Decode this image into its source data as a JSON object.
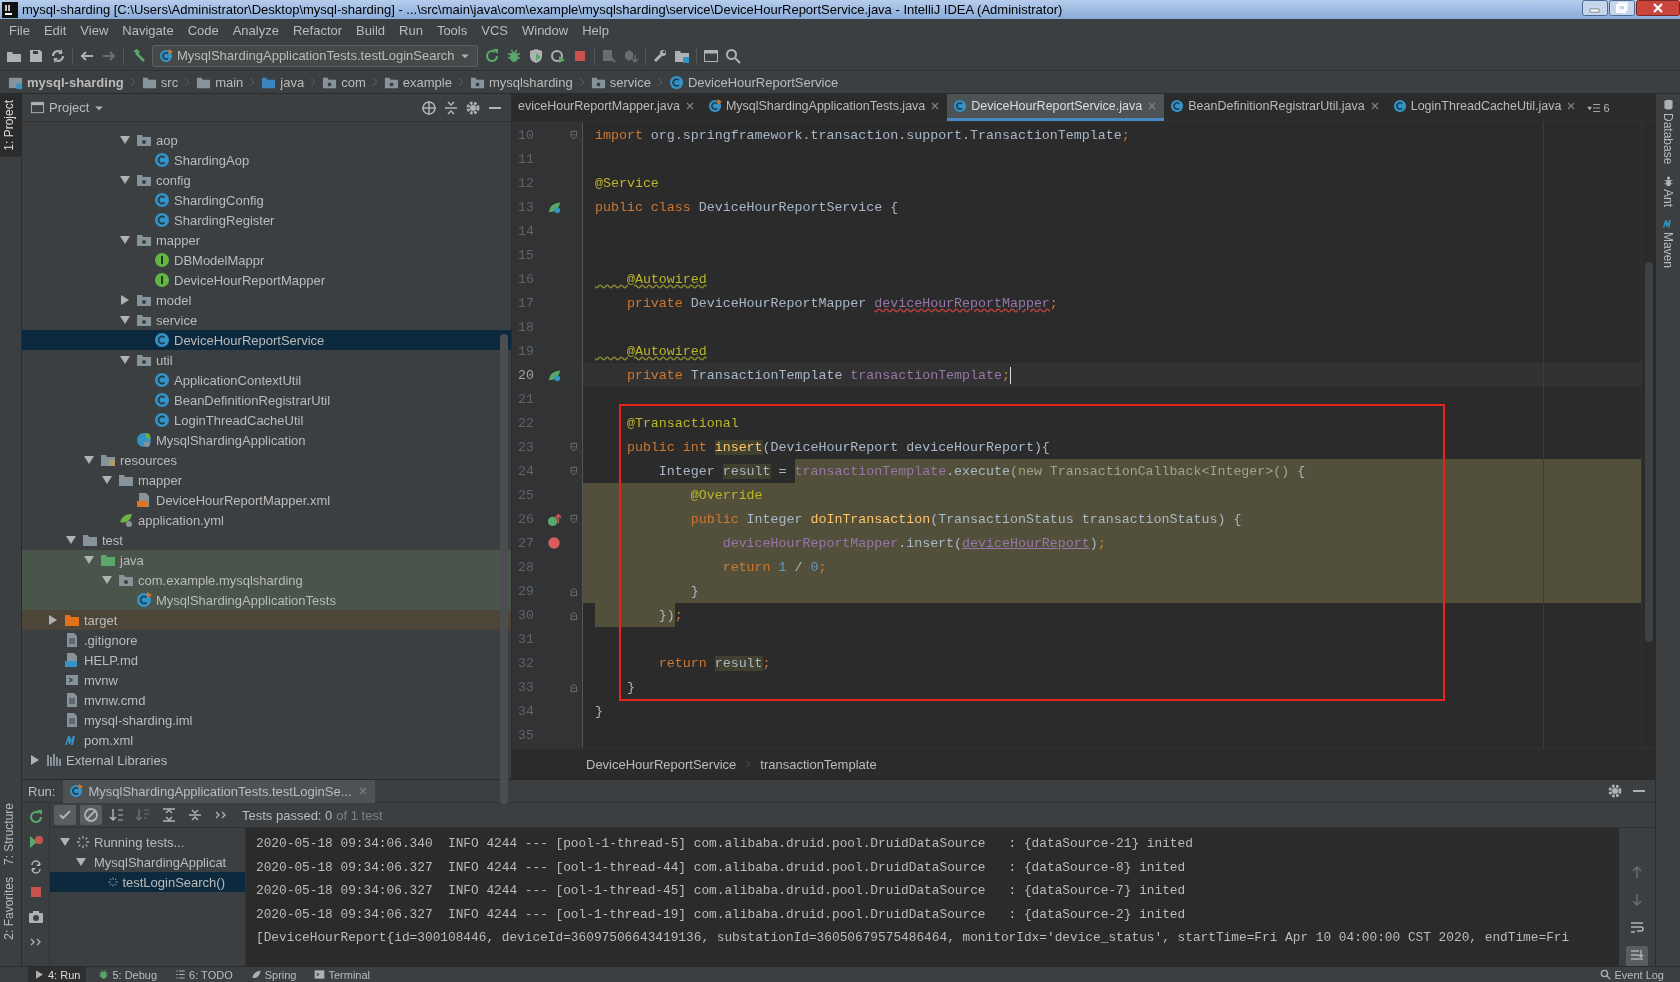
{
  "window": {
    "title": "mysql-sharding [C:\\Users\\Administrator\\Desktop\\mysql-sharding] - ...\\src\\main\\java\\com\\example\\mysqlsharding\\service\\DeviceHourReportService.java - IntelliJ IDEA (Administrator)"
  },
  "menu": [
    "File",
    "Edit",
    "View",
    "Navigate",
    "Code",
    "Analyze",
    "Refactor",
    "Build",
    "Run",
    "Tools",
    "VCS",
    "Window",
    "Help"
  ],
  "toolbar": [
    {
      "kind": "open",
      "disabled": false
    },
    {
      "kind": "save",
      "disabled": false
    },
    {
      "kind": "sync",
      "disabled": false
    },
    {
      "kind": "separator"
    },
    {
      "kind": "back",
      "disabled": false
    },
    {
      "kind": "forward",
      "disabled": true
    },
    {
      "kind": "separator"
    },
    {
      "kind": "hammer",
      "disabled": false
    },
    {
      "kind": "combo",
      "label": "MysqlShardingApplicationTests.testLoginSearch"
    },
    {
      "kind": "rerun",
      "disabled": false
    },
    {
      "kind": "bug",
      "disabled": false
    },
    {
      "kind": "coverage",
      "disabled": false
    },
    {
      "kind": "profile",
      "disabled": false
    },
    {
      "kind": "stop",
      "disabled": false
    },
    {
      "kind": "separator"
    },
    {
      "kind": "attach",
      "disabled": true
    },
    {
      "kind": "update",
      "disabled": true
    },
    {
      "kind": "separator"
    },
    {
      "kind": "wrench",
      "disabled": false
    },
    {
      "kind": "structure",
      "disabled": false
    },
    {
      "kind": "separator"
    },
    {
      "kind": "window",
      "disabled": false
    },
    {
      "kind": "search",
      "disabled": false
    }
  ],
  "nav_path": [
    {
      "label": "mysql-sharding",
      "kind": "module"
    },
    {
      "label": "src",
      "kind": "folder"
    },
    {
      "label": "main",
      "kind": "folder"
    },
    {
      "label": "java",
      "kind": "source"
    },
    {
      "label": "com",
      "kind": "package"
    },
    {
      "label": "example",
      "kind": "package"
    },
    {
      "label": "mysqlsharding",
      "kind": "package"
    },
    {
      "label": "service",
      "kind": "package"
    },
    {
      "label": "DeviceHourReportService",
      "kind": "class"
    }
  ],
  "left_strip": [
    {
      "label": "1: Project",
      "selected": true
    },
    {
      "label": "7: Structure",
      "selected": false
    },
    {
      "label": "2: Favorites",
      "selected": false
    }
  ],
  "right_strip": [
    {
      "label": "Database",
      "kind": "database"
    },
    {
      "label": "Ant",
      "kind": "ant"
    },
    {
      "label": "Maven",
      "kind": "maven"
    }
  ],
  "project_panel": {
    "title": "Project"
  },
  "project_tree": [
    {
      "children": [
        {
          "children": [
            {
              "children": [
                {
                  "children": [
                    {
                      "children": [
                        {
                          "label": "aop",
                          "kind": "package",
                          "expanded": true,
                          "selected": false,
                          "children": [
                            {
                              "label": "ShardingAop",
                              "kind": "class",
                              "selected": false
                            }
                          ]
                        },
                        {
                          "label": "config",
                          "kind": "package",
                          "expanded": true,
                          "selected": false,
                          "children": [
                            {
                              "label": "ShardingConfig",
                              "kind": "class",
                              "selected": false
                            },
                            {
                              "label": "ShardingRegister",
                              "kind": "class",
                              "selected": false
                            }
                          ]
                        },
                        {
                          "label": "mapper",
                          "kind": "package",
                          "expanded": true,
                          "selected": false,
                          "children": [
                            {
                              "label": "DBModelMappr",
                              "kind": "interface",
                              "selected": false
                            },
                            {
                              "label": "DeviceHourReportMapper",
                              "kind": "interface",
                              "selected": false
                            }
                          ]
                        },
                        {
                          "label": "model",
                          "kind": "package",
                          "expanded": false,
                          "selected": false
                        },
                        {
                          "label": "service",
                          "kind": "package",
                          "expanded": true,
                          "selected": false,
                          "children": [
                            {
                              "label": "DeviceHourReportService",
                              "kind": "class",
                              "selected": true
                            }
                          ]
                        },
                        {
                          "label": "util",
                          "kind": "package",
                          "expanded": true,
                          "selected": false,
                          "children": [
                            {
                              "label": "ApplicationContextUtil",
                              "kind": "class",
                              "selected": false
                            },
                            {
                              "label": "BeanDefinitionRegistrarUtil",
                              "kind": "class",
                              "selected": false
                            },
                            {
                              "label": "LoginThreadCacheUtil",
                              "kind": "class",
                              "selected": false
                            }
                          ]
                        },
                        {
                          "label": "MysqlShardingApplication",
                          "kind": "spring",
                          "selected": false
                        }
                      ]
                    }
                  ]
                },
                {
                  "label": "resources",
                  "kind": "resources",
                  "expanded": true,
                  "selected": false,
                  "children": [
                    {
                      "label": "mapper",
                      "kind": "folder",
                      "expanded": true,
                      "selected": false,
                      "children": [
                        {
                          "label": "DeviceHourReportMapper.xml",
                          "kind": "xml",
                          "selected": false
                        }
                      ]
                    },
                    {
                      "label": "application.yml",
                      "kind": "yml",
                      "selected": false
                    }
                  ]
                }
              ]
            },
            {
              "label": "test",
              "kind": "folder",
              "expanded": true,
              "selected": false,
              "children": [
                {
                  "label": "java",
                  "kind": "testsource",
                  "expanded": true,
                  "selected": false,
                  "test_source": true,
                  "children": [
                    {
                      "label": "com.example.mysqlsharding",
                      "kind": "package",
                      "expanded": true,
                      "selected": false,
                      "test_source": true,
                      "children": [
                        {
                          "label": "MysqlShardingApplicationTests",
                          "kind": "testclass",
                          "selected": false,
                          "test_source": true
                        }
                      ]
                    }
                  ]
                }
              ]
            }
          ]
        },
        {
          "label": "target",
          "kind": "excluded",
          "expanded": false,
          "selected": false,
          "excluded": true
        },
        {
          "label": ".gitignore",
          "kind": "file",
          "selected": false
        },
        {
          "label": "HELP.md",
          "kind": "md",
          "selected": false
        },
        {
          "label": "mvnw",
          "kind": "shell",
          "selected": false
        },
        {
          "label": "mvnw.cmd",
          "kind": "file",
          "selected": false
        },
        {
          "label": "mysql-sharding.iml",
          "kind": "file",
          "selected": false
        },
        {
          "label": "pom.xml",
          "kind": "maven",
          "selected": false
        }
      ]
    },
    {
      "label": "External Libraries",
      "kind": "libraries",
      "expanded": false,
      "selected": false
    }
  ],
  "editor_tabs": [
    {
      "label": "eviceHourReportMapper.java",
      "selected": false
    },
    {
      "label": "MysqlShardingApplicationTests.java",
      "kind": "testclass",
      "selected": false
    },
    {
      "label": "DeviceHourReportService.java",
      "kind": "class",
      "selected": true
    },
    {
      "label": "BeanDefinitionRegistrarUtil.java",
      "kind": "class",
      "selected": false
    },
    {
      "label": "LoginThreadCacheUtil.java",
      "kind": "class",
      "selected": false
    }
  ],
  "tab_overflow_count": "6",
  "code_lines": [
    {
      "number": "10",
      "kind": "plain",
      "fold_start": true,
      "tokens": [
        {
          "text": "import",
          "kind": "kw"
        },
        {
          "text": " org.springframework.transaction.support.TransactionTemplate",
          "kind": "plain"
        },
        {
          "text": ";",
          "kind": "kw"
        }
      ]
    },
    {
      "number": "11",
      "kind": "plain"
    },
    {
      "number": "12",
      "kind": "plain",
      "tokens": [
        {
          "text": "@Service",
          "kind": "ann"
        }
      ]
    },
    {
      "number": "13",
      "kind": "plain",
      "bean": true,
      "tokens": [
        {
          "text": "public class",
          "kind": "kw"
        },
        {
          "text": " DeviceHourReportService {",
          "kind": "plain"
        }
      ]
    },
    {
      "number": "14",
      "kind": "plain"
    },
    {
      "number": "15",
      "kind": "plain"
    },
    {
      "number": "16",
      "kind": "plain",
      "tokens": [
        {
          "text": "    @Autowired",
          "kind": "annw"
        }
      ]
    },
    {
      "number": "17",
      "kind": "plain",
      "tokens": [
        {
          "text": "    private",
          "kind": "kw"
        },
        {
          "text": " DeviceHourReportMapper ",
          "kind": "plain"
        },
        {
          "text": "deviceHourReportMapper",
          "kind": "ferr"
        },
        {
          "text": ";",
          "kind": "kw"
        }
      ]
    },
    {
      "number": "18",
      "kind": "plain"
    },
    {
      "number": "19",
      "kind": "plain",
      "tokens": [
        {
          "text": "    @Autowired",
          "kind": "annw"
        }
      ]
    },
    {
      "number": "20",
      "kind": "current",
      "bean": true,
      "caret": true,
      "tokens": [
        {
          "text": "    private",
          "kind": "kw"
        },
        {
          "text": " TransactionTemplate ",
          "kind": "plain"
        },
        {
          "text": "transactionTemplate",
          "kind": "field"
        },
        {
          "text": ";",
          "kind": "kw"
        }
      ]
    },
    {
      "number": "21",
      "kind": "plain"
    },
    {
      "number": "22",
      "kind": "plain",
      "framed": true,
      "tokens": [
        {
          "text": "    @Transactional",
          "kind": "ann"
        }
      ]
    },
    {
      "number": "23",
      "kind": "plain",
      "framed": true,
      "fold_start": true,
      "tokens": [
        {
          "text": "    public int ",
          "kind": "kw"
        },
        {
          "text": "insert",
          "kind": "method",
          "highlighted": true
        },
        {
          "text": "(DeviceHourReport deviceHourReport){",
          "kind": "plain"
        }
      ]
    },
    {
      "number": "24",
      "kind": "lambda-tail",
      "framed": true,
      "fold_start": true,
      "tokens": [
        {
          "text": "        Integer ",
          "kind": "plain"
        },
        {
          "text": "result",
          "kind": "plain",
          "highlighted": true
        },
        {
          "text": " = ",
          "kind": "plain"
        },
        {
          "text": "transactionTemplate",
          "kind": "field",
          "band": true
        },
        {
          "text": ".execute",
          "kind": "plain",
          "band": true
        },
        {
          "text": "(new TransactionCallback<Integer>()",
          "kind": "dim",
          "band": true
        },
        {
          "text": " {",
          "kind": "plain",
          "band": true
        }
      ]
    },
    {
      "number": "25",
      "kind": "lambda",
      "framed": true,
      "tokens": [
        {
          "text": "            @Override",
          "kind": "ann"
        }
      ]
    },
    {
      "number": "26",
      "kind": "lambda",
      "framed": true,
      "override": true,
      "fold_start": true,
      "tokens": [
        {
          "text": "            public",
          "kind": "kw"
        },
        {
          "text": " Integer ",
          "kind": "plain"
        },
        {
          "text": "doInTransaction",
          "kind": "method"
        },
        {
          "text": "(TransactionStatus transactionStatus) {",
          "kind": "plain"
        }
      ]
    },
    {
      "number": "27",
      "kind": "lambda",
      "framed": true,
      "breakpoint": true,
      "tokens": [
        {
          "text": "                deviceHourReportMapper",
          "kind": "field"
        },
        {
          "text": ".insert(",
          "kind": "plain"
        },
        {
          "text": "deviceHourReport",
          "kind": "param"
        },
        {
          "text": ")",
          "kind": "plain"
        },
        {
          "text": ";",
          "kind": "kw"
        }
      ]
    },
    {
      "number": "28",
      "kind": "lambda",
      "framed": true,
      "tokens": [
        {
          "text": "                return ",
          "kind": "kw"
        },
        {
          "text": "1",
          "kind": "num"
        },
        {
          "text": " / ",
          "kind": "plain"
        },
        {
          "text": "0",
          "kind": "num"
        },
        {
          "text": ";",
          "kind": "kw"
        }
      ]
    },
    {
      "number": "29",
      "kind": "lambda",
      "framed": true,
      "fold_end": true,
      "tokens": [
        {
          "text": "            }",
          "kind": "plain"
        }
      ]
    },
    {
      "number": "30",
      "kind": "lambda-head",
      "framed": true,
      "fold_end": true,
      "tokens": [
        {
          "text": "        })",
          "kind": "plain",
          "band": true
        },
        {
          "text": ";",
          "kind": "kw"
        }
      ]
    },
    {
      "number": "31",
      "kind": "plain",
      "framed": true
    },
    {
      "number": "32",
      "kind": "plain",
      "framed": true,
      "tokens": [
        {
          "text": "        return ",
          "kind": "kw"
        },
        {
          "text": "result",
          "kind": "plain",
          "highlighted": true
        },
        {
          "text": ";",
          "kind": "kw"
        }
      ]
    },
    {
      "number": "33",
      "kind": "plain",
      "framed": true,
      "fold_end": true,
      "tokens": [
        {
          "text": "    }",
          "kind": "plain"
        }
      ]
    },
    {
      "number": "34",
      "kind": "plain",
      "tokens": [
        {
          "text": "}",
          "kind": "plain"
        }
      ]
    },
    {
      "number": "35",
      "kind": "plain"
    }
  ],
  "editor_breadcrumb": [
    "DeviceHourReportService",
    "transactionTemplate"
  ],
  "run_panel": {
    "label": "Run:",
    "tab": "MysqlShardingApplicationTests.testLoginSe...",
    "side_tools": [
      {
        "kind": "rerun"
      },
      {
        "kind": "rerun-failed"
      },
      {
        "kind": "toggle"
      },
      {
        "kind": "stop"
      },
      {
        "kind": "camera"
      },
      {
        "kind": "more"
      }
    ],
    "test_tools": [
      {
        "kind": "check",
        "on": true
      },
      {
        "kind": "cancel",
        "on": true
      },
      {
        "kind": "sort-alpha",
        "on": false
      },
      {
        "kind": "sort-duration",
        "on": false
      },
      {
        "kind": "expand",
        "on": false
      },
      {
        "kind": "collapse",
        "on": false
      },
      {
        "kind": "more",
        "on": false
      }
    ],
    "status": "Tests passed: 0",
    "status_detail": "of 1 test",
    "tests": [
      {
        "label": "Running tests...",
        "selected": false,
        "children": [
          {
            "label": "MysqlShardingApplicat",
            "selected": false,
            "children": [
              {
                "label": "testLoginSearch()",
                "selected": true
              }
            ]
          }
        ]
      }
    ],
    "console": [
      "2020-05-18 09:34:06.340  INFO 4244 --- [pool-1-thread-5] com.alibaba.druid.pool.DruidDataSource   : {dataSource-21} inited",
      "2020-05-18 09:34:06.327  INFO 4244 --- [ool-1-thread-44] com.alibaba.druid.pool.DruidDataSource   : {dataSource-8} inited",
      "2020-05-18 09:34:06.327  INFO 4244 --- [ool-1-thread-45] com.alibaba.druid.pool.DruidDataSource   : {dataSource-7} inited",
      "2020-05-18 09:34:06.327  INFO 4244 --- [ool-1-thread-19] com.alibaba.druid.pool.DruidDataSource   : {dataSource-2} inited",
      "[DeviceHourReport{id=300108446, deviceId=36097506643419136, substationId=36050679575486464, monitorIdx='device_status', startTime=Fri Apr 10 04:00:00 CST 2020, endTime=Fri"
    ],
    "console_tools": [
      {
        "kind": "up",
        "on": false
      },
      {
        "kind": "down",
        "on": false
      },
      {
        "kind": "wrap",
        "on": false
      },
      {
        "kind": "scroll-end",
        "on": true
      }
    ]
  },
  "tool_windows": [
    {
      "label": "4: Run",
      "kind": "run",
      "selected": true
    },
    {
      "label": "5: Debug",
      "kind": "bug",
      "selected": false
    },
    {
      "label": "6: TODO",
      "kind": "todo",
      "selected": false
    },
    {
      "label": "Spring",
      "kind": "leaf",
      "selected": false
    },
    {
      "label": "Terminal",
      "kind": "terminal",
      "selected": false
    }
  ],
  "event_log": "Event Log"
}
